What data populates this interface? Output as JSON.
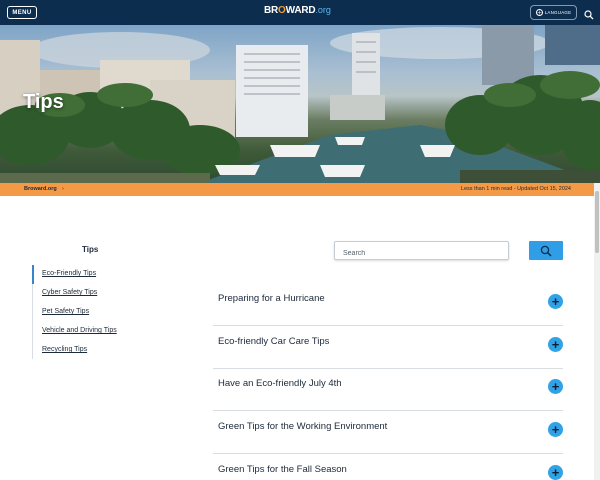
{
  "header": {
    "menu_label": "MENU",
    "logo_text_pre": "BR",
    "logo_text_o": "O",
    "logo_text_post": "WARD",
    "logo_domain": ".org",
    "language_label": "LANGUAGE"
  },
  "hero": {
    "title": "Tips"
  },
  "breadcrumb": {
    "home": "Broward.org",
    "arrow": "›",
    "read_time": "Less than 1 min read - Updated Oct 15, 2024"
  },
  "sidebar": {
    "title": "Tips",
    "items": [
      {
        "label": "Eco-Friendly Tips"
      },
      {
        "label": "Cyber Safety Tips"
      },
      {
        "label": "Pet Safety Tips"
      },
      {
        "label": "Vehicle and Driving Tips"
      },
      {
        "label": "Recycling Tips"
      }
    ]
  },
  "search": {
    "placeholder": "Search"
  },
  "accordion": {
    "items": [
      {
        "label": "Preparing for a Hurricane"
      },
      {
        "label": "Eco-friendly Car Care Tips"
      },
      {
        "label": "Have an Eco-friendly July 4th"
      },
      {
        "label": "Green Tips for the Working Environment"
      },
      {
        "label": "Green Tips for the Fall Season"
      }
    ]
  },
  "colors": {
    "topbar": "#0d2d4f",
    "accent_orange": "#f49a46",
    "accent_blue": "#2fa3e8"
  }
}
